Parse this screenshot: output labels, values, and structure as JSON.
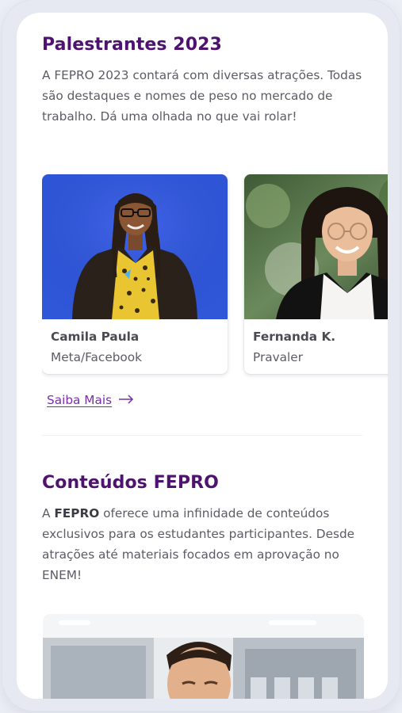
{
  "speakers_section": {
    "title": "Palestrantes 2023",
    "description": "A FEPRO 2023 contará com diversas atrações. Todas são destaques e nomes de peso no mercado de trabalho. Dá uma olhada no que vai rolar!",
    "speakers": [
      {
        "name": "Camila Paula",
        "org": "Meta/Facebook"
      },
      {
        "name": "Fernanda K.",
        "org": "Pravaler"
      }
    ],
    "more_link": {
      "label": "Saiba Mais",
      "icon": "arrow-right-icon"
    }
  },
  "content_section": {
    "title": "Conteúdos FEPRO",
    "description_lead": "A ",
    "description_strong": "FEPRO",
    "description_rest": " oferece uma infinidade de conteúdos exclusivos para os estudantes participantes. Desde atrações até materiais focados em aprovação no ENEM!"
  },
  "colors": {
    "title_purple": "#4e136f",
    "link_purple": "#7a2ea8",
    "body_text": "#5c5c66",
    "photo_blue_bg": "#2f57d8"
  }
}
